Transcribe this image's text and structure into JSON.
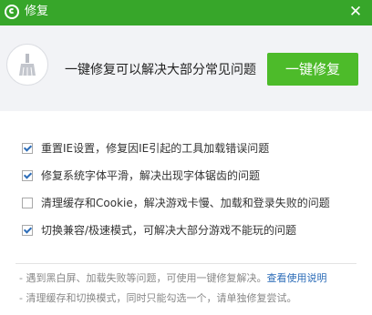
{
  "window": {
    "title": "修复"
  },
  "header": {
    "description": "一键修复可以解决大部分常见问题",
    "fix_button_label": "一键修复"
  },
  "options": [
    {
      "label": "重置IE设置，修复因IE引起的工具加载错误问题",
      "checked": true
    },
    {
      "label": "修复系统字体平滑，解决出现字体锯齿的问题",
      "checked": true
    },
    {
      "label": "清理缓存和Cookie，解决游戏卡慢、加载和登录失败的问题",
      "checked": false
    },
    {
      "label": "切换兼容/极速模式，可解决大部分游戏不能玩的问题",
      "checked": true
    }
  ],
  "notes": {
    "line1": "- 遇到黑白屏、加载失败等问题，可使用一键修复解决。",
    "help_link": "查看使用说明",
    "line2": "- 清理缓存和切换模式，同时只能勾选一个，请单独修复尝试。"
  },
  "colors": {
    "titlebar": "#37a62a",
    "button": "#4dbb2a",
    "link": "#2d6db8",
    "header_bg": "#f2f3f6"
  },
  "icons": {
    "title": "app-logo-icon",
    "close": "close-icon",
    "header": "broom-icon"
  }
}
